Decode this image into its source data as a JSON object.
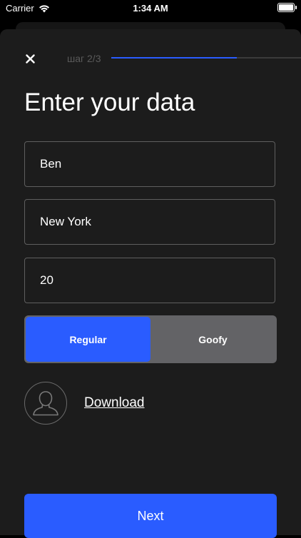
{
  "status_bar": {
    "carrier": "Carrier",
    "time": "1:34 AM"
  },
  "header": {
    "close_icon": "close-icon",
    "step_label": "шаг 2/3",
    "progress": 0.66
  },
  "title": "Enter your data",
  "fields": {
    "name": "Ben",
    "city": "New York",
    "age": "20"
  },
  "stance": {
    "options": [
      "Regular",
      "Goofy"
    ],
    "selected": "Regular"
  },
  "photo": {
    "avatar_icon": "user-silhouette-icon",
    "download_label": "Download"
  },
  "next_button": "Next",
  "colors": {
    "accent": "#2a5cff",
    "sheet_background": "#1c1c1c",
    "segment_inactive": "#636366"
  }
}
